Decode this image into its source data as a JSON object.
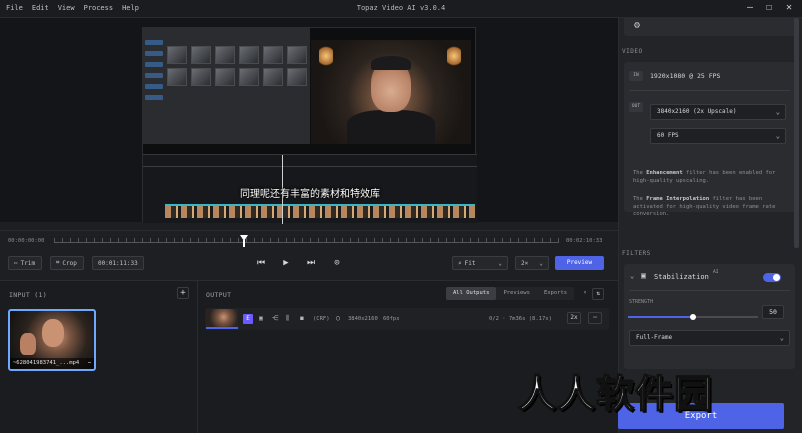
{
  "menu": [
    "File",
    "Edit",
    "View",
    "Process",
    "Help"
  ],
  "app_title": "Topaz Video AI  v3.0.4",
  "window_controls": {
    "minimize": "—",
    "maximize": "☐",
    "close": "✕"
  },
  "preview": {
    "subtitle": "同理呢还有丰富的素材和特效库"
  },
  "scrubber": {
    "start_time": "00:00:00:00",
    "end_time": "00:02:10:33",
    "position_fraction": 0.38
  },
  "controls": {
    "trim_label": "Trim",
    "crop_label": "Crop",
    "timecode": "00:01:11:33",
    "zoom_label": "Fit",
    "speed_label": "2×",
    "preview_label": "Preview"
  },
  "input": {
    "title": "INPUT (1)",
    "file_label": "~628041983741_...mp4",
    "more_icon": "⋯"
  },
  "output": {
    "title": "OUTPUT",
    "tabs": [
      "All Outputs",
      "Previews",
      "Exports"
    ],
    "row": {
      "badge": "E",
      "resolution": "3840x2160",
      "fps_label": "60fps",
      "codec_label": "(CRF)",
      "progress_text": "0/2 · 7m36s (8.17x)",
      "mode_tag": "2x"
    }
  },
  "sidebar": {
    "video_section": "VIDEO",
    "input_tag": "IN",
    "input_spec": "1920x1080 @ 25 FPS",
    "output_tag": "OUT",
    "output_resolution": "3840x2160 (2x Upscale)",
    "output_fps": "60 FPS",
    "note1_prefix": "The ",
    "note1_bold": "Enhancement",
    "note1_suffix": " filter has been enabled for high-quality upscaling.",
    "note2_prefix": "The ",
    "note2_bold": "Frame Interpolation",
    "note2_suffix": " filter has been activated for high-quality video frame rate conversion.",
    "filters_section": "FILTERS",
    "stabilization_label": "Stabilization",
    "stabilization_enabled": true,
    "strength_label": "STRENGTH",
    "strength_value": "50",
    "stabilization_mode": "Full-Frame",
    "export_label": "Export"
  },
  "watermark": "人人软件园",
  "colors": {
    "accent": "#4e63e6",
    "background": "#1e1f22",
    "sidebar": "#232428"
  }
}
